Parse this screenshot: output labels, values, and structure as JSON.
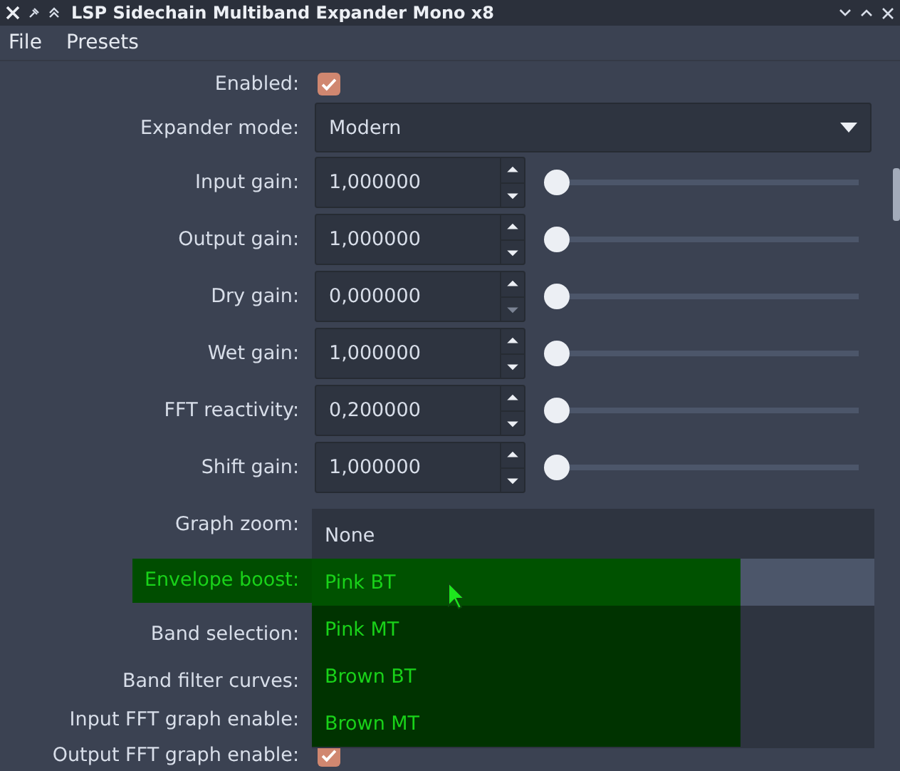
{
  "window": {
    "title": "LSP Sidechain Multiband Expander Mono x8"
  },
  "menu": [
    "File",
    "Presets"
  ],
  "rows": [
    {
      "kind": "checkbox",
      "label": "Enabled:",
      "checked": true,
      "highlighted": false
    },
    {
      "kind": "combo",
      "label": "Expander mode:",
      "value": "Modern",
      "highlighted": false
    },
    {
      "kind": "spin",
      "label": "Input gain:",
      "value": "1,000000",
      "level": 0,
      "highlighted": false
    },
    {
      "kind": "spin",
      "label": "Output gain:",
      "value": "1,000000",
      "level": 0,
      "highlighted": false
    },
    {
      "kind": "spin",
      "label": "Dry gain:",
      "value": "0,000000",
      "level": 0,
      "down_disabled": true,
      "highlighted": false
    },
    {
      "kind": "spin",
      "label": "Wet gain:",
      "value": "1,000000",
      "level": 0,
      "highlighted": false
    },
    {
      "kind": "spin",
      "label": "FFT reactivity:",
      "value": "0,200000",
      "level": 0,
      "highlighted": false
    },
    {
      "kind": "spin",
      "label": "Shift gain:",
      "value": "1,000000",
      "level": 0,
      "highlighted": false
    },
    {
      "kind": "spin",
      "label": "Graph zoom:",
      "highlighted": false
    },
    {
      "kind": "combo",
      "label": "Envelope boost:",
      "highlighted": true
    },
    {
      "kind": "combo",
      "label": "Band selection:",
      "highlighted": false
    },
    {
      "kind": "short",
      "label": "Band filter curves:",
      "highlighted": false
    },
    {
      "kind": "checkbox",
      "label": "Input FFT graph enable:",
      "highlighted": false
    },
    {
      "kind": "checkbox",
      "label": "Output FFT graph enable:",
      "checked": true,
      "highlighted": false
    }
  ],
  "dropdown": {
    "items": [
      {
        "label": "None",
        "selected": false,
        "highlighted": false
      },
      {
        "label": "Pink BT",
        "selected": true,
        "highlighted": true
      },
      {
        "label": "Pink MT",
        "selected": false,
        "highlighted": true
      },
      {
        "label": "Brown BT",
        "selected": false,
        "highlighted": true
      },
      {
        "label": "Brown MT",
        "selected": false,
        "highlighted": true
      }
    ]
  }
}
